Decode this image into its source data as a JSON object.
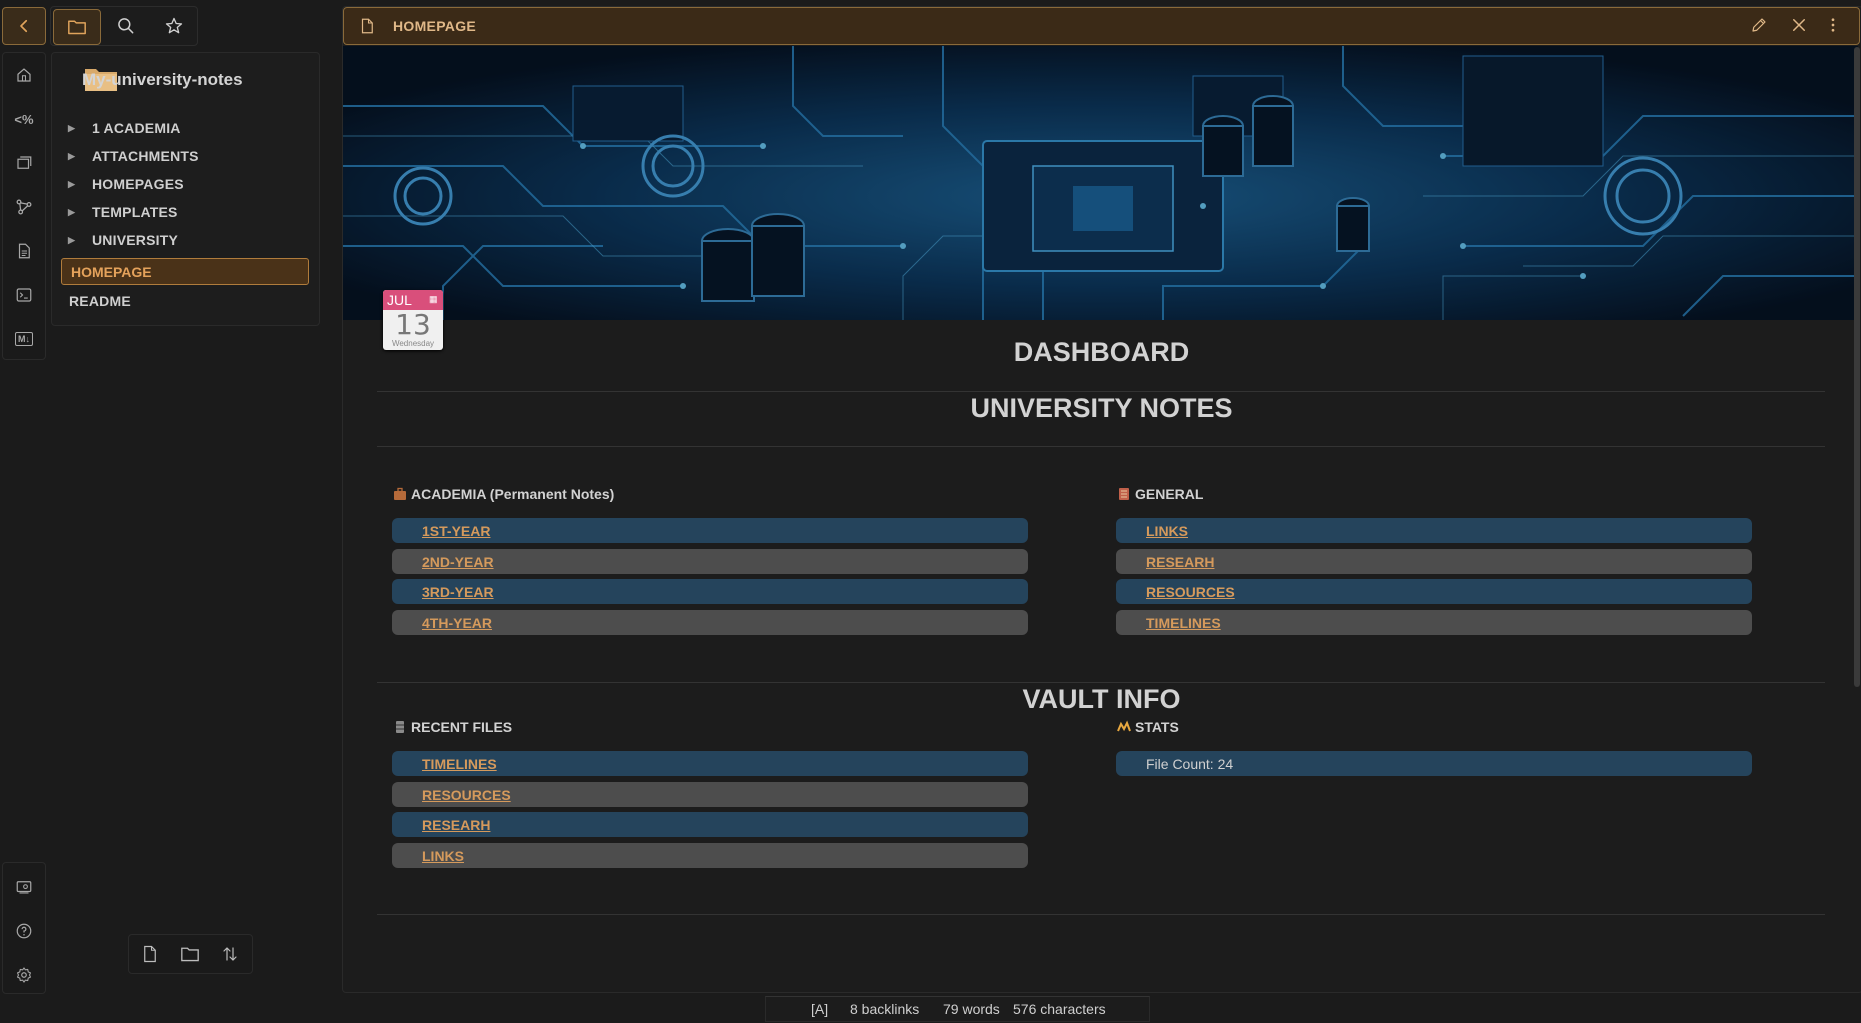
{
  "top_buttons": {
    "back_icon": "chevron-left-icon",
    "tabs": [
      "folder-icon",
      "search-icon",
      "star-icon"
    ]
  },
  "ribbon": {
    "top": [
      "home-icon",
      "code-percent-icon",
      "windows-icon",
      "graph-icon",
      "document-icon",
      "terminal-icon",
      "markdown-icon"
    ],
    "code_label": "<%",
    "markdown_label": "M↓",
    "bottom": [
      "vault-switch-icon",
      "help-icon",
      "settings-icon"
    ]
  },
  "explorer": {
    "vault_name": "My-university-notes",
    "folders": [
      "1 ACADEMIA",
      "ATTACHMENTS",
      "HOMEPAGES",
      "TEMPLATES",
      "UNIVERSITY"
    ],
    "files": [
      "HOMEPAGE",
      "README"
    ],
    "active_file": "HOMEPAGE",
    "bottom_tools": [
      "new-note-icon",
      "new-folder-icon",
      "sort-icon"
    ]
  },
  "tab": {
    "title": "HOMEPAGE",
    "actions": [
      "edit-icon",
      "close-icon",
      "more-options-icon"
    ]
  },
  "calendar": {
    "month": "JUL",
    "day": "13",
    "weekday": "Wednesday"
  },
  "content": {
    "dashboard_title": "DASHBOARD",
    "notes_title": "UNIVERSITY NOTES",
    "academia": {
      "label": "ACADEMIA (Permanent Notes)",
      "items": [
        "1ST-YEAR",
        "2ND-YEAR",
        "3RD-YEAR",
        "4TH-YEAR"
      ]
    },
    "general": {
      "label": "GENERAL",
      "items": [
        "LINKS",
        "RESEARH",
        "RESOURCES",
        "TIMELINES"
      ]
    },
    "vault_title": "VAULT INFO",
    "recent": {
      "label": "RECENT FILES",
      "items": [
        "TIMELINES",
        "RESOURCES",
        "RESEARH",
        "LINKS"
      ]
    },
    "stats": {
      "label": "STATS",
      "file_count": "File Count: 24"
    }
  },
  "status_bar": {
    "mode": "[A]",
    "backlinks": "8 backlinks",
    "words": "79 words",
    "characters": "576 characters"
  },
  "colors": {
    "accent": "#b07c3c",
    "accent_bg": "#3b2a17",
    "row_blue": "#25445c",
    "row_grey": "#4d4d4d",
    "link": "#d59a5c",
    "calendar_header": "#d94f7b"
  }
}
